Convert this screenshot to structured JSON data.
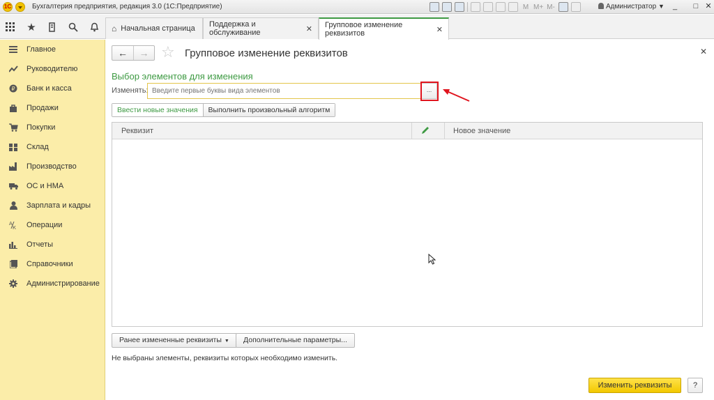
{
  "window": {
    "logo": "1С",
    "title": "Бухгалтерия предприятия, редакция 3.0  (1С:Предприятие)",
    "toolbar_m": [
      "M",
      "M+",
      "M-"
    ],
    "user": "Администратор",
    "win_buttons": [
      "_",
      "□",
      "✕"
    ]
  },
  "tabs": [
    {
      "label": "Начальная страница",
      "active": false
    },
    {
      "label": "Поддержка и обслуживание",
      "active": false,
      "close": "✕"
    },
    {
      "label": "Групповое изменение реквизитов",
      "active": true,
      "close": "✕"
    }
  ],
  "sidebar": {
    "items": [
      {
        "label": "Главное",
        "icon": "menu-icon"
      },
      {
        "label": "Руководителю",
        "icon": "trend-icon"
      },
      {
        "label": "Банк и касса",
        "icon": "ruble-icon"
      },
      {
        "label": "Продажи",
        "icon": "bag-icon"
      },
      {
        "label": "Покупки",
        "icon": "cart-icon"
      },
      {
        "label": "Склад",
        "icon": "warehouse-icon"
      },
      {
        "label": "Производство",
        "icon": "factory-icon"
      },
      {
        "label": "ОС и НМА",
        "icon": "truck-icon"
      },
      {
        "label": "Зарплата и кадры",
        "icon": "person-icon"
      },
      {
        "label": "Операции",
        "icon": "operations-icon"
      },
      {
        "label": "Отчеты",
        "icon": "bar-chart-icon"
      },
      {
        "label": "Справочники",
        "icon": "book-icon"
      },
      {
        "label": "Администрирование",
        "icon": "gear-icon"
      }
    ]
  },
  "form": {
    "title": "Групповое изменение реквизитов",
    "section_title": "Выбор элементов для изменения",
    "field_label": "Изменять:",
    "field_placeholder": "Введите первые буквы вида элементов",
    "select_button": "...",
    "mode_buttons": [
      {
        "label": "Ввести новые значения",
        "selected": true
      },
      {
        "label": "Выполнить произвольный алгоритм",
        "selected": false
      }
    ],
    "table": {
      "columns": [
        "Реквизит",
        "Новое значение"
      ],
      "rows": []
    },
    "prev_button": "Ранее измененные реквизиты",
    "extra_button": "Дополнительные параметры...",
    "status": "Не выбраны элементы, реквизиты которых необходимо изменить.",
    "submit_button": "Изменить реквизиты",
    "help_button": "?"
  },
  "colors": {
    "accent_green": "#3e9a43",
    "sidebar_bg": "#fbeda9",
    "primary_yellow": "#f2c800",
    "highlight_red": "#e0141e"
  }
}
